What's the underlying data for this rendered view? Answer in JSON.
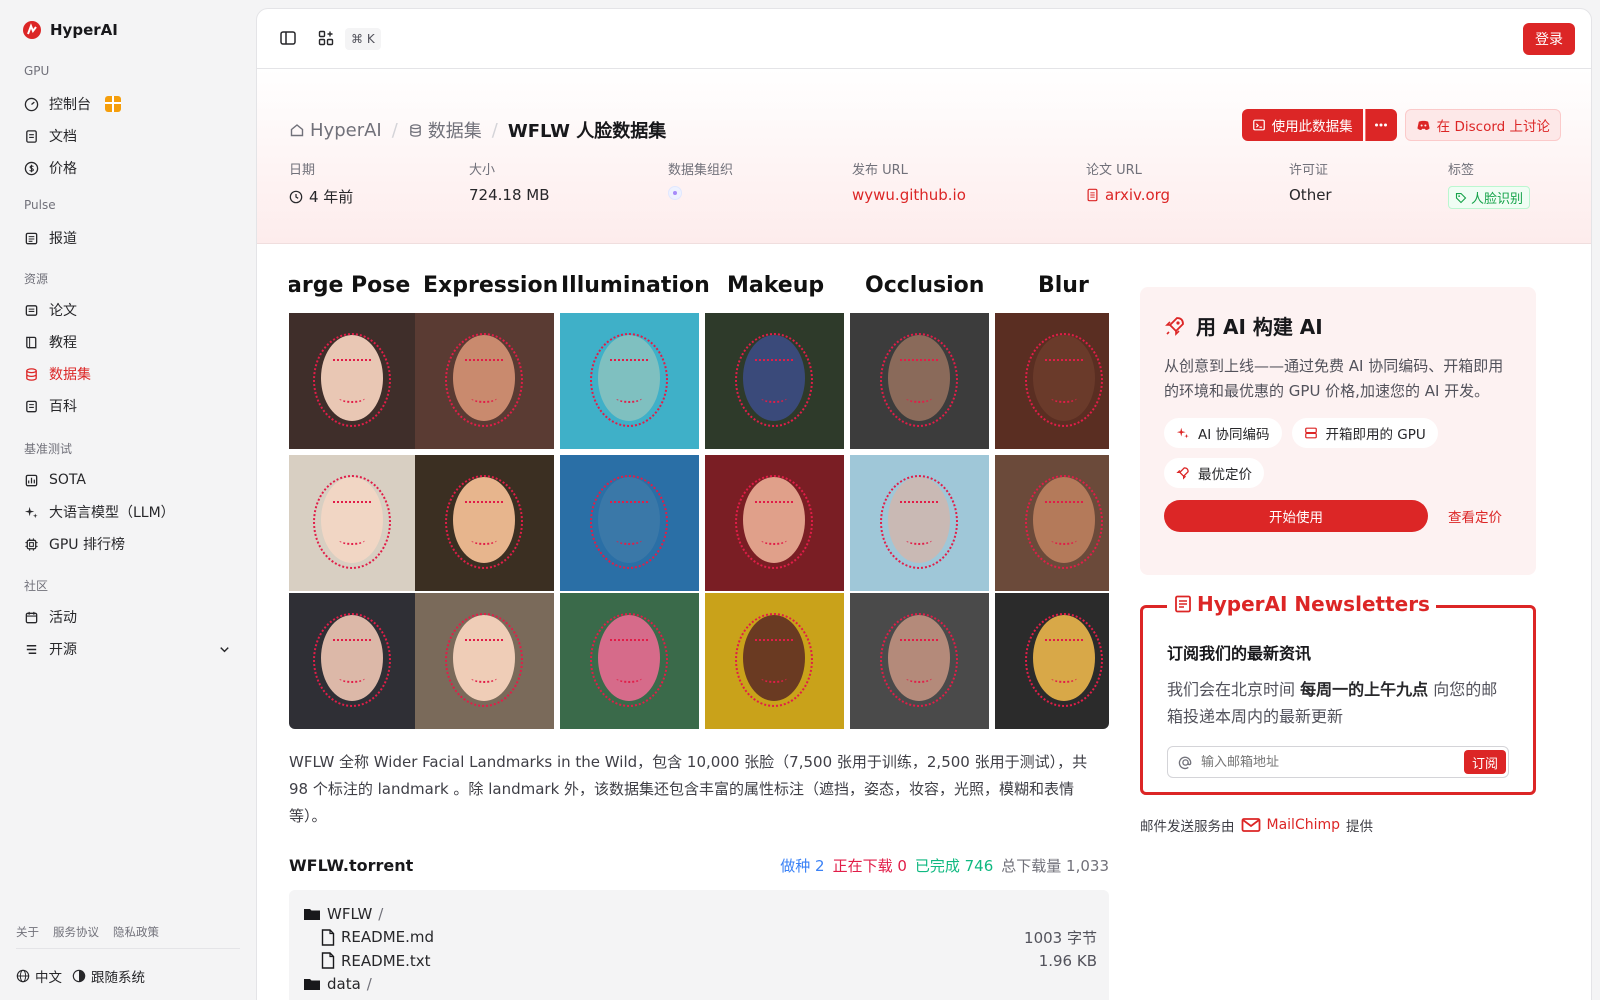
{
  "sidebar": {
    "brand": "HyperAI",
    "sections": [
      {
        "label": "GPU",
        "items": [
          "控制台",
          "文档",
          "价格"
        ]
      },
      {
        "label": "Pulse",
        "items": [
          "报道"
        ]
      },
      {
        "label": "资源",
        "items": [
          "论文",
          "教程",
          "数据集",
          "百科"
        ]
      },
      {
        "label": "基准测试",
        "items": [
          "SOTA",
          "大语言模型（LLM）",
          "GPU 排行榜"
        ]
      },
      {
        "label": "社区",
        "items": [
          "活动",
          "开源"
        ]
      }
    ],
    "active_item": "数据集",
    "footer_links": [
      "关于",
      "服务协议",
      "隐私政策"
    ],
    "language": "中文",
    "theme": "跟随系统"
  },
  "topbar": {
    "shortcut": "⌘ K",
    "login": "登录"
  },
  "breadcrumb": {
    "home": "HyperAI",
    "section": "数据集",
    "current": "WFLW 人脸数据集"
  },
  "actions": {
    "use_dataset": "使用此数据集",
    "discord": "在 Discord 上讨论"
  },
  "meta": [
    {
      "label": "日期",
      "value": "4 年前"
    },
    {
      "label": "大小",
      "value": "724.18 MB"
    },
    {
      "label": "数据集组织",
      "value": ""
    },
    {
      "label": "发布 URL",
      "value": "wywu.github.io"
    },
    {
      "label": "论文 URL",
      "value": "arxiv.org"
    },
    {
      "label": "许可证",
      "value": "Other"
    },
    {
      "label": "标签",
      "value": "人脸识别"
    }
  ],
  "figure": {
    "categories": [
      "arge Pose",
      "Expression",
      "Illumination",
      "Makeup",
      "Occlusion",
      "Blur"
    ]
  },
  "description": "WFLW 全称 Wider Facial Landmarks in the Wild，包含 10,000 张脸（7,500 张用于训练，2,500 张用于测试），共 98 个标注的 landmark 。除 landmark 外，该数据集还包含丰富的属性标注（遮挡，姿态，妆容，光照，模糊和表情等）。",
  "torrent": {
    "name": "WFLW.torrent",
    "seeding": "做种 2",
    "downloading": "正在下载 0",
    "completed": "已完成 746",
    "total": "总下载量 1,033",
    "files": [
      {
        "name": "WFLW",
        "type": "folder",
        "size": ""
      },
      {
        "name": "README.md",
        "type": "file",
        "size": "1003 字节"
      },
      {
        "name": "README.txt",
        "type": "file",
        "size": "1.96 KB"
      },
      {
        "name": "data",
        "type": "folder",
        "size": ""
      }
    ]
  },
  "ai_card": {
    "title": "用 AI 构建 AI",
    "desc": "从创意到上线——通过免费 AI 协同编码、开箱即用的环境和最优惠的 GPU 价格,加速您的 AI 开发。",
    "chips": [
      "AI 协同编码",
      "开箱即用的 GPU",
      "最优定价"
    ],
    "start": "开始使用",
    "pricing": "查看定价"
  },
  "newsletter": {
    "title": "HyperAI Newsletters",
    "heading": "订阅我们的最新资讯",
    "text_before": "我们会在北京时间 ",
    "text_bold": "每周一的上午九点",
    "text_after": " 向您的邮箱投递本周内的最新更新",
    "placeholder": "输入邮箱地址",
    "subscribe": "订阅"
  },
  "mailchimp": {
    "before": "邮件发送服务由",
    "brand": "MailChimp",
    "after": "提供"
  },
  "colors": {
    "accent": "#dc2626",
    "seeding": "#3b82f6",
    "downloading": "#e11d48",
    "completed": "#10b981"
  }
}
